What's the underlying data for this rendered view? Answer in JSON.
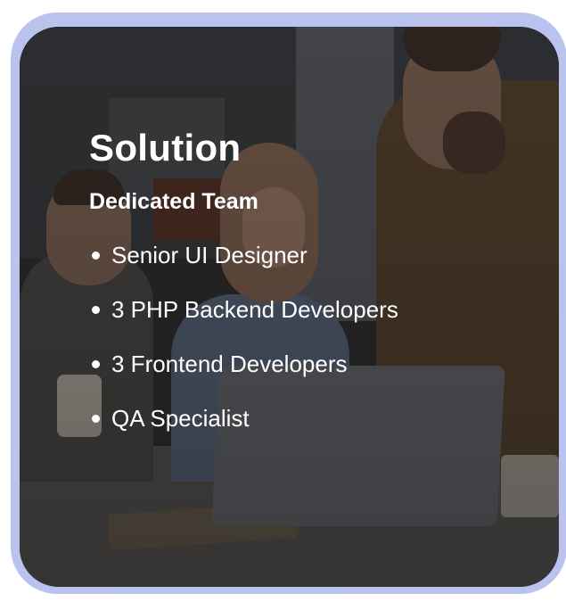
{
  "colors": {
    "frame": "#b9c3ee",
    "text": "#ffffff"
  },
  "card": {
    "title": "Solution",
    "subtitle": "Dedicated Team",
    "roles": [
      "Senior UI Designer",
      "3 PHP Backend Developers",
      "3 Frontend Developers",
      "QA Specialist"
    ]
  }
}
